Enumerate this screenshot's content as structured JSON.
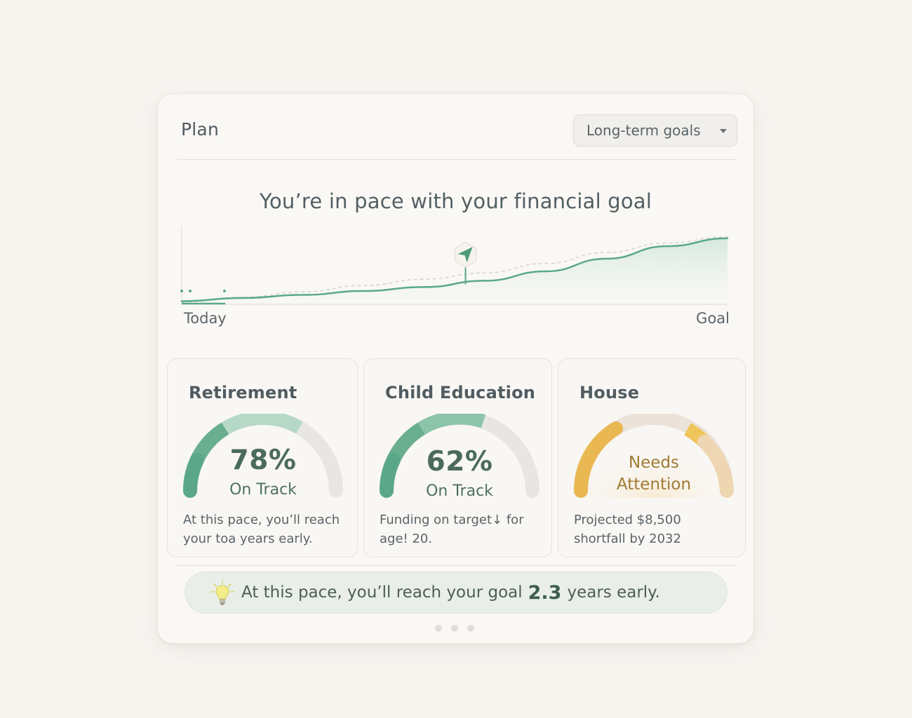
{
  "header": {
    "title": "Plan",
    "dropdown_label": "Long-term goals"
  },
  "summary": {
    "headline": "You’re in pace with your financial goal",
    "axis_start": "Today",
    "axis_end": "Goal"
  },
  "chart_data": {
    "type": "area",
    "title": "You’re in pace with your financial goal",
    "xlabel": "",
    "ylabel": "",
    "x_labels": [
      "Today",
      "Goal"
    ],
    "series": [
      {
        "values": [
          0.04,
          0.08,
          0.12,
          0.17,
          0.22,
          0.3,
          0.42,
          0.58,
          0.74,
          0.84
        ]
      },
      {
        "values": [
          0.03,
          0.09,
          0.16,
          0.24,
          0.32,
          0.4,
          0.52,
          0.66,
          0.78,
          0.86
        ]
      }
    ],
    "marker_position": 0.52,
    "colors": {
      "line": "#5aa889",
      "projection": "#d8d3cb",
      "fill": "#cfe4d8"
    }
  },
  "goals": [
    {
      "title": "Retirement",
      "percent_text": "78%",
      "percent": 78,
      "status": "On Track",
      "description": "At this pace, you’ll reach your toa years early.",
      "color": "#5aa889"
    },
    {
      "title": "Child Education",
      "percent_text": "62%",
      "percent": 62,
      "status": "On Track",
      "description": "Funding on target↓ for age! 20.",
      "color": "#5aa889"
    },
    {
      "title": "House",
      "status_line1": "Needs",
      "status_line2": "Attention",
      "description": "Projected $8,500 shortfall by 2032",
      "color": "#e4b04f"
    }
  ],
  "banner": {
    "prefix": "At this pace, you’ll reach your goal",
    "number": "2.3",
    "suffix": "years early.",
    "icon": "lightbulb-icon"
  },
  "pagination": {
    "pages": 3,
    "current": 1
  }
}
